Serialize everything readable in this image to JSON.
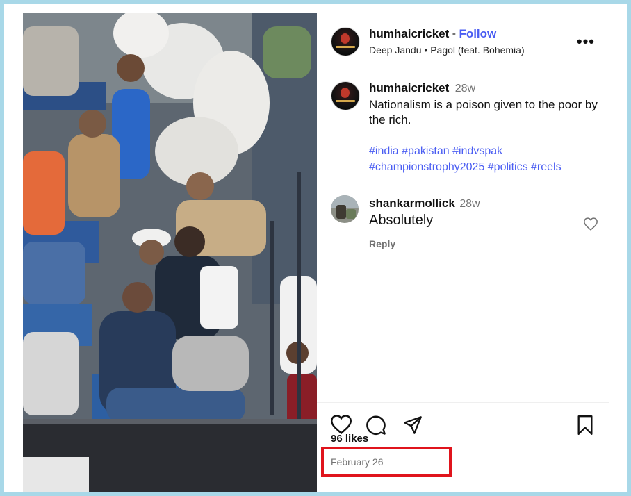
{
  "post": {
    "username": "humhaicricket",
    "follow_label": "Follow",
    "separator": "•",
    "audio_artist": "Deep Jandu",
    "audio_track": "Pagol (feat. Bohemia)",
    "more_icon": "more-horizontal-icon"
  },
  "caption": {
    "username": "humhaicricket",
    "time": "28w",
    "text": "Nationalism is a poison given to the poor by the rich.",
    "hashtags_line1": "#india #pakistan #indvspak",
    "hashtags_line2": "#championstrophy2025 #politics #reels"
  },
  "comments": [
    {
      "username": "shankarmollick",
      "time": "28w",
      "text": "Absolutely",
      "reply_label": "Reply"
    }
  ],
  "actions": {
    "like_icon": "heart-icon",
    "comment_icon": "comment-icon",
    "share_icon": "share-icon",
    "save_icon": "bookmark-icon"
  },
  "likes": "96 likes",
  "date": "February 26",
  "colors": {
    "link": "#4a5df2",
    "highlight": "#e0141c",
    "background": "#a8d8e8"
  }
}
